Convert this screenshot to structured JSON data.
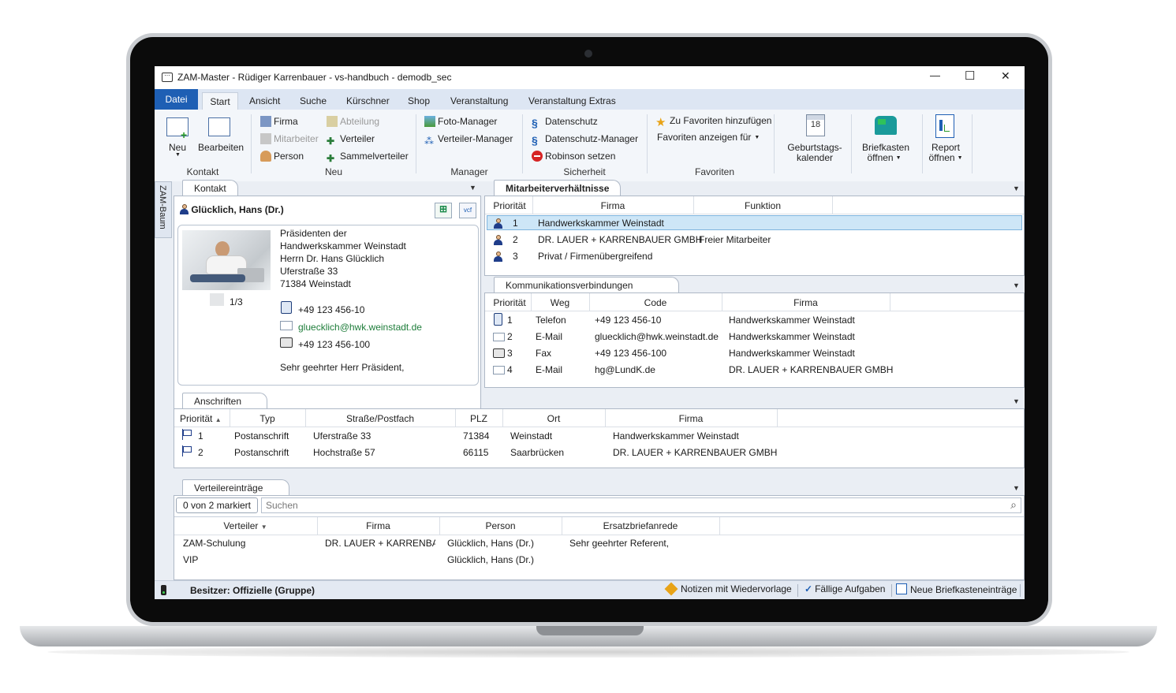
{
  "window": {
    "title": "ZAM-Master - Rüdiger Karrenbauer - vs-handbuch - demodb_sec",
    "minimize": "—",
    "maximize": "☐",
    "close": "✕"
  },
  "ribbon_tabs": [
    "Datei",
    "Start",
    "Ansicht",
    "Suche",
    "Kürschner",
    "Shop",
    "Veranstaltung",
    "Veranstaltung Extras"
  ],
  "ribbon": {
    "neu_label": "Neu",
    "bearbeiten_label": "Bearbeiten",
    "group_kontakt": "Kontakt",
    "firma": "Firma",
    "mitarbeiter": "Mitarbeiter",
    "person": "Person",
    "abteilung": "Abteilung",
    "verteiler": "Verteiler",
    "sammelverteiler": "Sammelverteiler",
    "group_neu": "Neu",
    "foto_manager": "Foto-Manager",
    "verteiler_manager": "Verteiler-Manager",
    "group_manager": "Manager",
    "datenschutz": "Datenschutz",
    "datenschutz_manager": "Datenschutz-Manager",
    "robinson": "Robinson setzen",
    "group_sicherheit": "Sicherheit",
    "zu_favoriten": "Zu Favoriten hinzufügen",
    "favoriten_anzeigen": "Favoriten anzeigen für",
    "group_favoriten": "Favoriten",
    "geburtstag_line1": "Geburtstags-",
    "geburtstag_line2": "kalender",
    "calendar_day": "18",
    "briefkasten_line1": "Briefkasten",
    "briefkasten_line2": "öffnen",
    "report_line1": "Report",
    "report_line2": "öffnen"
  },
  "side_tab": "ZAM-Baum",
  "kontakt": {
    "tab": "Kontakt",
    "name": "Glücklich, Hans (Dr.)",
    "vcf_label": "vcf",
    "address_lines": [
      "Präsidenten der",
      "Handwerkskammer Weinstadt",
      "Herrn Dr. Hans Glücklich",
      "Uferstraße 33",
      "71384 Weinstadt"
    ],
    "photo_counter": "1/3",
    "phone": "+49 123 456-10",
    "email": "gluecklich@hwk.weinstadt.de",
    "fax": "+49 123 456-100",
    "salutation": "Sehr geehrter Herr Präsident,"
  },
  "mitarbeiter": {
    "tab": "Mitarbeiterverhältnisse",
    "headers": [
      "Priorität",
      "Firma",
      "Funktion"
    ],
    "rows": [
      {
        "prio": "1",
        "firma": "Handwerkskammer Weinstadt",
        "funktion": ""
      },
      {
        "prio": "2",
        "firma": "DR. LAUER + KARRENBAUER GMBH",
        "funktion": "Freier Mitarbeiter"
      },
      {
        "prio": "3",
        "firma": "Privat / Firmenübergreifend",
        "funktion": ""
      }
    ]
  },
  "kommunikation": {
    "tab": "Kommunikationsverbindungen",
    "headers": [
      "Priorität",
      "Weg",
      "Code",
      "Firma"
    ],
    "rows": [
      {
        "prio": "1",
        "weg": "Telefon",
        "code": "+49 123 456-10",
        "firma": "Handwerkskammer Weinstadt",
        "icon": "phone-icon"
      },
      {
        "prio": "2",
        "weg": "E-Mail",
        "code": "gluecklich@hwk.weinstadt.de",
        "firma": "Handwerkskammer Weinstadt",
        "icon": "envelope-icon"
      },
      {
        "prio": "3",
        "weg": "Fax",
        "code": "+49 123 456-100",
        "firma": "Handwerkskammer Weinstadt",
        "icon": "fax-icon"
      },
      {
        "prio": "4",
        "weg": "E-Mail",
        "code": "hg@LundK.de",
        "firma": "DR. LAUER + KARRENBAUER GMBH",
        "icon": "envelope-icon"
      }
    ]
  },
  "anschriften": {
    "tab": "Anschriften",
    "headers": [
      "Priorität",
      "Typ",
      "Straße/Postfach",
      "PLZ",
      "Ort",
      "Firma"
    ],
    "rows": [
      {
        "prio": "1",
        "typ": "Postanschrift",
        "strasse": "Uferstraße 33",
        "plz": "71384",
        "ort": "Weinstadt",
        "firma": "Handwerkskammer Weinstadt"
      },
      {
        "prio": "2",
        "typ": "Postanschrift",
        "strasse": "Hochstraße 57",
        "plz": "66115",
        "ort": "Saarbrücken",
        "firma": "DR. LAUER + KARRENBAUER GMBH"
      }
    ]
  },
  "verteiler": {
    "tab": "Verteilereinträge",
    "marked": "0 von 2 markiert",
    "search_placeholder": "Suchen",
    "headers": [
      "Verteiler",
      "Firma",
      "Person",
      "Ersatzbriefanrede"
    ],
    "rows": [
      {
        "verteiler": "ZAM-Schulung",
        "firma": "DR. LAUER + KARRENBAUI",
        "person": "Glücklich, Hans (Dr.)",
        "anrede": "Sehr geehrter Referent,"
      },
      {
        "verteiler": "VIP",
        "firma": "",
        "person": "Glücklich, Hans (Dr.)",
        "anrede": ""
      }
    ]
  },
  "status": {
    "besitzer": "Besitzer: Offizielle (Gruppe)",
    "notizen": "Notizen mit Wiedervorlage",
    "aufgaben": "Fällige Aufgaben",
    "briefkasten": "Neue Briefkasteneinträge"
  },
  "colors": {
    "accent": "#1e5fb4",
    "selection": "#cde6f7",
    "link": "#1e7d3a"
  }
}
